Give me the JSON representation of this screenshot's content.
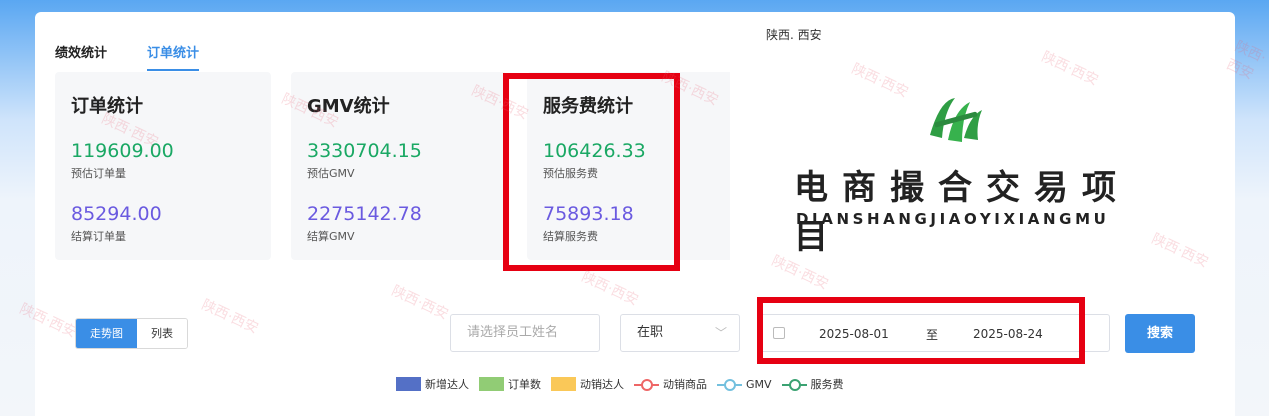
{
  "tabs": [
    {
      "label": "绩效统计",
      "active": false
    },
    {
      "label": "订单统计",
      "active": true
    }
  ],
  "cards": [
    {
      "title": "订单统计",
      "value1": "119609.00",
      "label1": "预估订单量",
      "value2": "85294.00",
      "label2": "结算订单量"
    },
    {
      "title": "GMV统计",
      "value1": "3330704.15",
      "label1": "预估GMV",
      "value2": "2275142.78",
      "label2": "结算GMV"
    },
    {
      "title": "服务费统计",
      "value1": "106426.33",
      "label1": "预估服务费",
      "value2": "75893.18",
      "label2": "结算服务费"
    }
  ],
  "logo": {
    "region": "陕西. 西安",
    "title_cn": "电商撮合交易项目",
    "title_en": "DIANSHANGJIAOYIXIANGMU"
  },
  "watermark_text": "陕西·西安",
  "view_toggle": {
    "chart_label": "走势图",
    "list_label": "列表",
    "active": "chart"
  },
  "filters": {
    "employee_placeholder": "请选择员工姓名",
    "status_value": "在职",
    "date_start": "2025-08-01",
    "date_sep": "至",
    "date_end": "2025-08-24",
    "search_label": "搜索"
  },
  "legend": [
    {
      "label": "新增达人",
      "kind": "bar",
      "color": "#5470c6"
    },
    {
      "label": "订单数",
      "kind": "bar",
      "color": "#91cc75"
    },
    {
      "label": "动销达人",
      "kind": "bar",
      "color": "#fac858"
    },
    {
      "label": "动销商品",
      "kind": "line",
      "color": "#ee6666"
    },
    {
      "label": "GMV",
      "kind": "line",
      "color": "#73c0de"
    },
    {
      "label": "服务费",
      "kind": "line",
      "color": "#3ba272"
    }
  ],
  "colors": {
    "accent": "#3a8ee6",
    "highlight": "#e60012",
    "value_green": "#1aa864",
    "value_purple": "#6a5ae0"
  }
}
